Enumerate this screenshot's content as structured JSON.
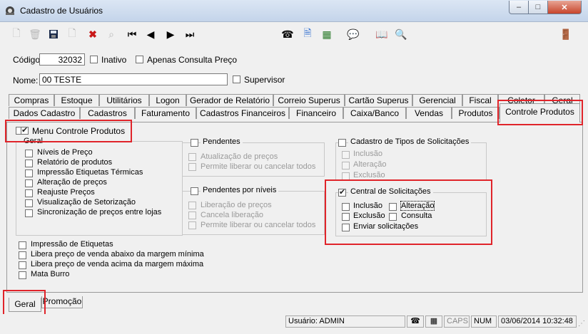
{
  "window": {
    "title": "Cadastro de Usuários",
    "minimize": "–",
    "maximize": "□",
    "close": "✕"
  },
  "toolbar": {
    "left_icons": [
      "new-doc-icon",
      "delete-icon",
      "save-icon",
      "copy-icon",
      "cancel-icon",
      "search-disabled-icon",
      "first-record-icon",
      "prev-record-icon",
      "next-record-icon",
      "last-record-icon"
    ],
    "right_icons": [
      "phone-icon",
      "add-doc-icon",
      "report-icon",
      "chat-icon",
      "book-icon",
      "zoom-icon",
      "exit-door-icon"
    ]
  },
  "form": {
    "codigo_label": "Código:",
    "codigo_value": "32032",
    "inativo_label": "Inativo",
    "apenas_label": "Apenas Consulta Preço",
    "nome_label": "Nome:",
    "nome_value": "00 TESTE",
    "supervisor_label": "Supervisor"
  },
  "tabs_row1": [
    "Compras",
    "Estoque",
    "Utilitários",
    "Logon",
    "Gerador de Relatório",
    "Correio Superus",
    "Cartão Superus",
    "Gerencial",
    "Fiscal",
    "Coletor",
    "Geral"
  ],
  "tabs_row2": [
    "Dados Cadastro",
    "Cadastros",
    "Faturamento",
    "Cadastros Financeiros",
    "Financeiro",
    "Caixa/Banco",
    "Vendas",
    "Produtos",
    "Controle Produtos"
  ],
  "panel": {
    "menu_controle_label": "Menu Controle Produtos",
    "geral": {
      "title": "Geral",
      "items": [
        "Níveis de Preço",
        "Relatório de produtos",
        "Impressão Etiquetas Térmicas",
        "Alteração de preços",
        "Reajuste Preços",
        "Visualização de Setorização",
        "Sincronização de preços entre lojas"
      ]
    },
    "pendentes": {
      "title": "Pendentes",
      "items": [
        "Atualização de preços",
        "Permite liberar ou cancelar todos"
      ]
    },
    "pendentes_niveis": {
      "title": "Pendentes por níveis",
      "items": [
        "Liberação de preços",
        "Cancela liberação",
        "Permite liberar ou cancelar todos"
      ]
    },
    "cadastro_tipos": {
      "title": "Cadastro de Tipos de Solicitações",
      "items": [
        "Inclusão",
        "Alteração",
        "Exclusão"
      ]
    },
    "central": {
      "title": "Central de Solicitações",
      "inclusao": "Inclusão",
      "alteracao": "Alteração",
      "exclusao": "Exclusão",
      "consulta": "Consulta",
      "enviar": "Enviar solicitações"
    },
    "extra_items": [
      "Impressão de Etiquetas",
      "Libera preço de venda abaixo da margem mínima",
      "Libera preço de venda acima da margem máxima",
      "Mata Burro"
    ]
  },
  "bottom_tabs": [
    "Geral",
    "Promoção"
  ],
  "status": {
    "usuario": "Usuário: ADMIN",
    "caps": "CAPS",
    "num": "NUM",
    "datetime": "03/06/2014 10:32:48"
  },
  "colors": {
    "highlight": "#e0242a",
    "titlebar": "#c4d4ea"
  }
}
